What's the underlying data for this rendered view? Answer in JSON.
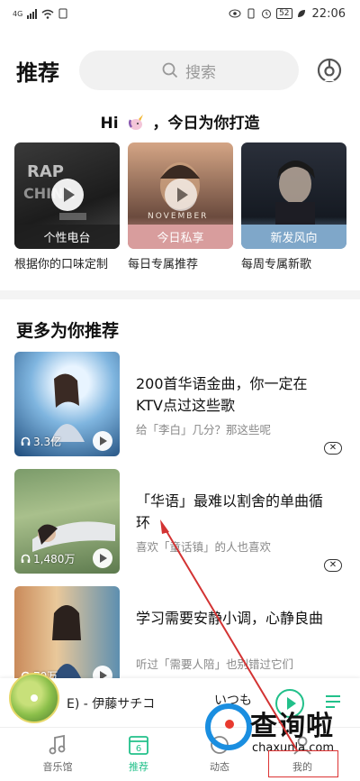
{
  "status_bar": {
    "signal": "4G",
    "battery": "52",
    "time": "22:06"
  },
  "header": {
    "title": "推荐",
    "search_placeholder": "搜索"
  },
  "greeting": {
    "prefix": "Hi",
    "suffix": "，今日为你打造"
  },
  "cards": [
    {
      "label": "个性电台",
      "desc": "根据你的口味定制",
      "colors": [
        "#2b2b2b",
        "#5a5a5a"
      ]
    },
    {
      "label": "今日私享",
      "desc": "每日专属推荐",
      "bar_color": "#d9a0a0"
    },
    {
      "label": "新发风向",
      "desc": "每周专属新歌",
      "bar_color": "#7ea6c8"
    }
  ],
  "section": {
    "title": "更多为你推荐"
  },
  "recommendations": [
    {
      "title": "200首华语金曲，你一定在KTV点过这些歌",
      "subtitle": "给「李白」几分？那这些呢",
      "play_count": "3.3亿"
    },
    {
      "title": "「华语」最难以割舍的单曲循环",
      "subtitle": "喜欢「童话镇」的人也喜欢",
      "play_count": "1,480万"
    },
    {
      "title": "学习需要安静小调，心静良曲",
      "subtitle": "听过「需要人陪」也别错过它们",
      "play_count": "70万"
    }
  ],
  "mini_player": {
    "song": "E) - 伊藤サチコ",
    "lyric": "いつも"
  },
  "bottom_nav": [
    {
      "label": "音乐馆",
      "icon": "music-note-icon"
    },
    {
      "label": "推荐",
      "icon": "calendar-6-icon",
      "active": true,
      "badge": "6"
    },
    {
      "label": "动态",
      "icon": "dynamic-icon"
    },
    {
      "label": "我的",
      "icon": "profile-icon"
    }
  ],
  "watermark": {
    "text": "查询啦",
    "url": "chaxunla.com"
  },
  "colors": {
    "accent": "#22c08a",
    "annotation": "#d33333"
  }
}
